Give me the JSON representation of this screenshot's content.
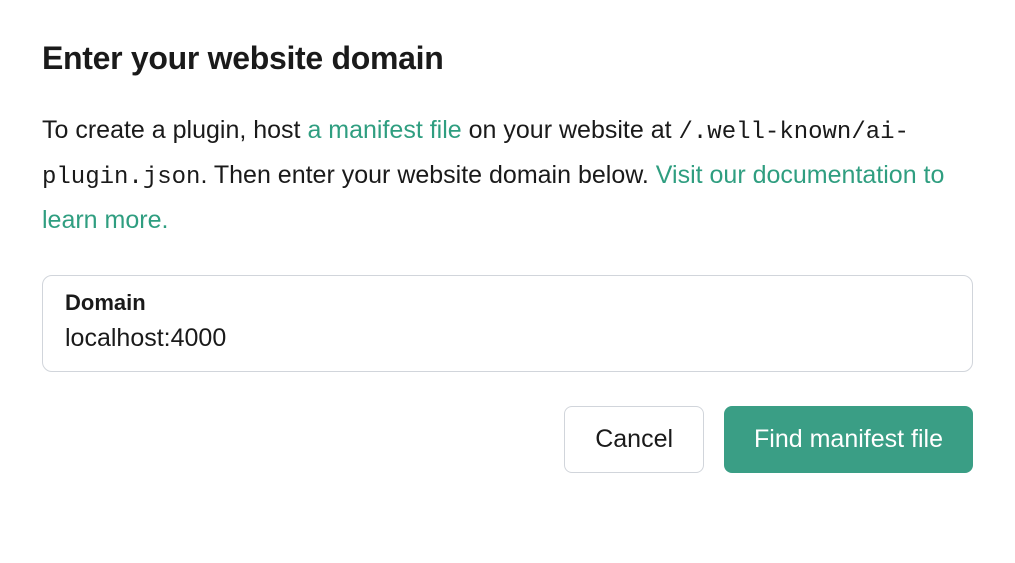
{
  "dialog": {
    "title": "Enter your website domain",
    "description": {
      "part1": "To create a plugin, host ",
      "link1": "a manifest file",
      "part2": " on your website at ",
      "path": "/.well-known/ai-plugin.json",
      "part3": ". Then enter your website domain below. ",
      "link2": "Visit our documentation to learn more."
    },
    "input": {
      "label": "Domain",
      "value": "localhost:4000"
    },
    "buttons": {
      "cancel": "Cancel",
      "submit": "Find manifest file"
    }
  },
  "colors": {
    "accent": "#3a9e85",
    "link": "#2f9e80",
    "border": "#d1d5db",
    "text": "#1a1a1a"
  }
}
